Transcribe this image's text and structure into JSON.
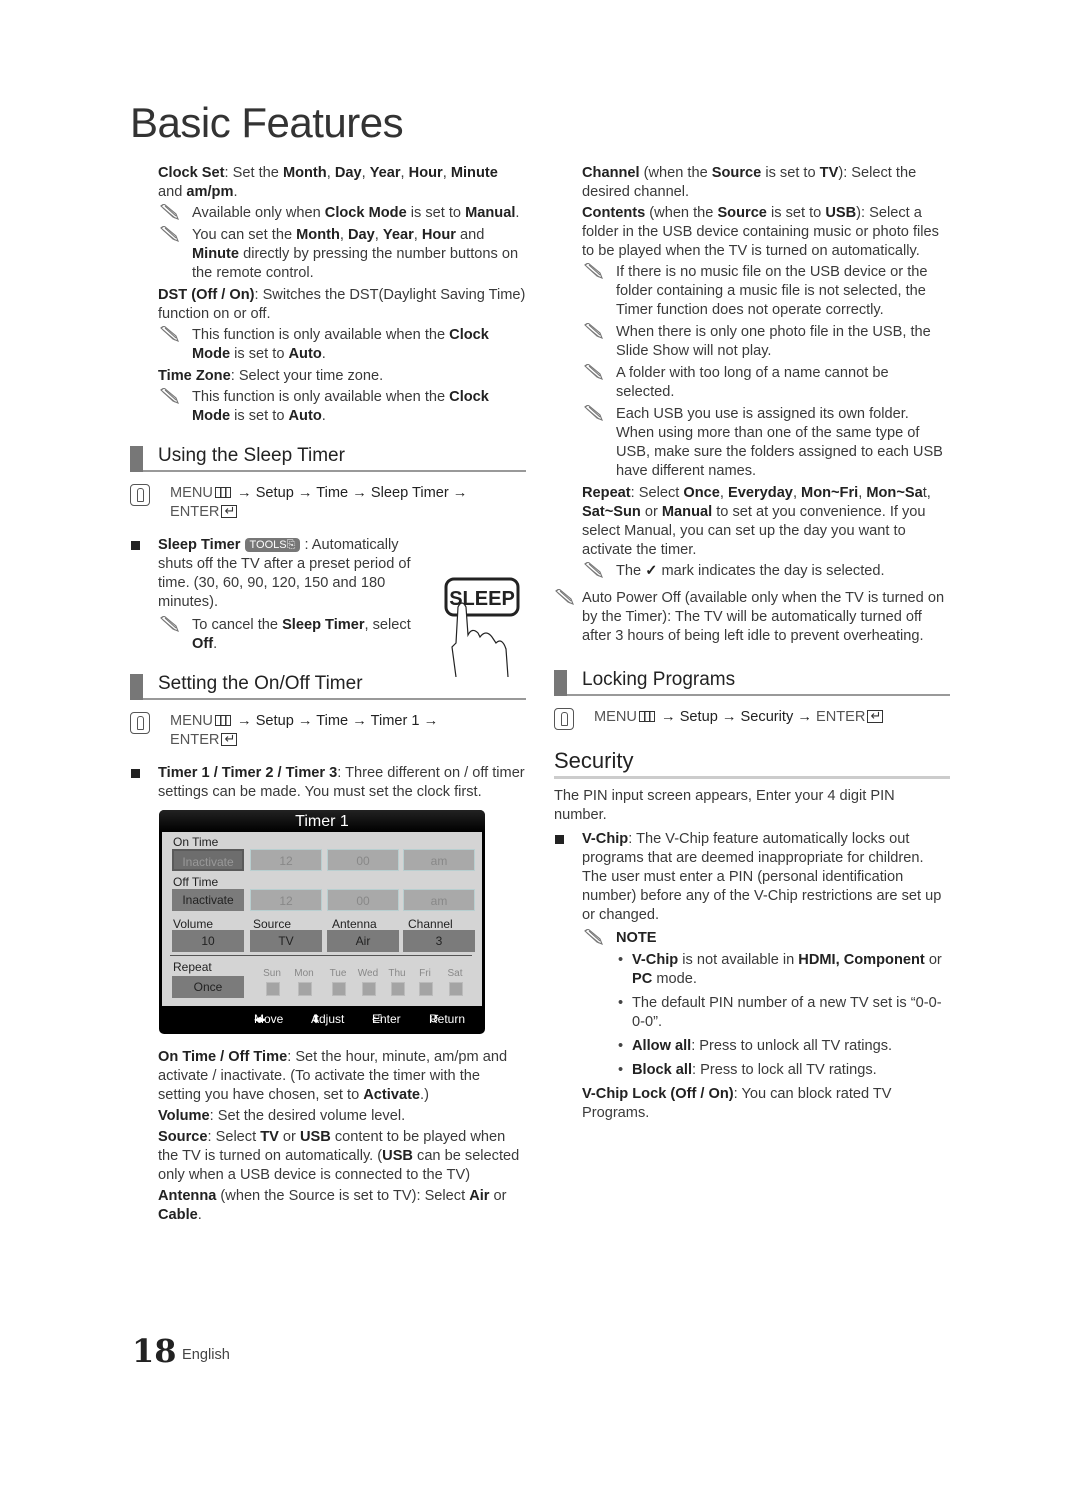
{
  "page": {
    "title": "Basic Features",
    "page_number": "18",
    "language": "English"
  },
  "icons": {
    "note": "pencil-note-icon",
    "remote": "remote-hand-icon",
    "menu": "menu-icon",
    "enter": "enter-icon",
    "tools": "tools-icon",
    "sleep_button": "sleep-button-icon"
  },
  "left": {
    "clock_set": {
      "label": "Clock Set",
      "text": ": Set the ",
      "b1": "Month",
      "s1": ", ",
      "b2": "Day",
      "s2": ", ",
      "b3": "Year",
      "s3": ", ",
      "b4": "Hour",
      "s4": ", ",
      "b5": "Minute",
      "s5": " and ",
      "b6": "am/pm",
      "end": "."
    },
    "note1": {
      "t1": "Available only when ",
      "b1": "Clock Mode",
      "t2": " is set to ",
      "b2": "Manual",
      "t3": "."
    },
    "note2": {
      "t1": "You can set the ",
      "b1": "Month",
      "s1": ", ",
      "b2": "Day",
      "s2": ", ",
      "b3": "Year",
      "s3": ", ",
      "b4": "Hour",
      "t2": " and ",
      "b5": "Minute",
      "t3": " directly by pressing the number buttons on the remote control."
    },
    "dst": {
      "label": "DST (Off / On)",
      "text": ": Switches the DST(Daylight Saving Time) function on or off."
    },
    "note3": {
      "t1": "This function is only available when the ",
      "b1": "Clock Mode",
      "t2": " is set to ",
      "b2": "Auto",
      "t3": "."
    },
    "time_zone": {
      "label": "Time Zone",
      "text": ": Select your time zone."
    },
    "note4": {
      "t1": "This function is only available when the ",
      "b1": "Clock Mode",
      "t2": " is set to ",
      "b2": "Auto",
      "t3": "."
    },
    "sleep_section": {
      "heading": "Using the Sleep Timer",
      "menu": "MENU",
      "path": "→ Setup → Time → Sleep Timer →",
      "enter": "ENTER",
      "bullet_label": "Sleep Timer",
      "tools": "TOOLS",
      "bullet_text": " : Automatically shuts off the TV after a preset period of time. (30, 60, 90, 120, 150 and 180 minutes).",
      "note": {
        "t1": "To cancel the ",
        "b1": "Sleep Timer",
        "t2": ", select ",
        "b2": "Off",
        "t3": "."
      },
      "sleep_button_label": "SLEEP"
    },
    "timer_section": {
      "heading": "Setting the On/Off Timer",
      "menu": "MENU",
      "path": "→ Setup → Time → Timer 1 →",
      "enter": "ENTER",
      "bullet_label": "Timer 1 / Timer 2 / Timer 3",
      "bullet_text": ": Three different on / off timer settings can be made. You must set the clock first."
    },
    "osd": {
      "title": "Timer 1",
      "on_time_label": "On Time",
      "on_time": [
        "Inactivate",
        "12",
        "00",
        "am"
      ],
      "off_time_label": "Off Time",
      "off_time": [
        "Inactivate",
        "12",
        "00",
        "am"
      ],
      "volume_label": "Volume",
      "volume": "10",
      "source_label": "Source",
      "source": "TV",
      "antenna_label": "Antenna",
      "antenna": "Air",
      "channel_label": "Channel",
      "channel": "3",
      "repeat_label": "Repeat",
      "repeat": "Once",
      "days": [
        "Sun",
        "Mon",
        "Tue",
        "Wed",
        "Thu",
        "Fri",
        "Sat"
      ],
      "footer": {
        "move": "Move",
        "adjust": "Adjust",
        "enter": "Enter",
        "return": "Return"
      }
    },
    "on_off_time": {
      "label": "On Time / Off Time",
      "t1": ": Set the hour, minute, am/pm and activate / inactivate. (To activate the timer with the setting you have chosen, set to ",
      "b1": "Activate",
      "t2": ".)"
    },
    "volume": {
      "label": "Volume",
      "text": ": Set the desired volume level."
    },
    "source": {
      "label": "Source",
      "t1": ": Select ",
      "b1": "TV",
      "t2": " or ",
      "b2": "USB",
      "t3": " content to be played when the TV is turned on automatically. (",
      "b3": "USB",
      "t4": " can be selected only when a USB device is connected to the TV)"
    },
    "antenna": {
      "label": "Antenna",
      "t1": " (when the Source is set to TV): Select ",
      "b1": "Air",
      "t2": " or ",
      "b2": "Cable",
      "t3": "."
    }
  },
  "right": {
    "channel": {
      "label": "Channel",
      "t1": " (when the ",
      "b1": "Source",
      "t2": " is set to ",
      "b2": "TV",
      "t3": "): Select the desired channel."
    },
    "contents": {
      "label": "Contents",
      "t1": " (when the ",
      "b1": "Source",
      "t2": " is set to ",
      "b2": "USB",
      "t3": "): Select a folder in the USB device containing music or photo files to be played when the TV is turned on automatically."
    },
    "notes": [
      "If there is no music file on the USB device or the folder containing a music file is not selected, the Timer function does not operate correctly.",
      "When there is only one photo file in the USB, the Slide Show will not play.",
      "A folder with too long of a name cannot be selected.",
      "Each USB you use is assigned its own folder. When using more than one of the same type of USB, make sure the folders assigned to each USB have different names."
    ],
    "repeat": {
      "label": "Repeat",
      "t1": ": Select ",
      "b1": "Once",
      "s1": ", ",
      "b2": "Everyday",
      "s2": ", ",
      "b3": "Mon~Fri",
      "s3": ", ",
      "b4": "Mon~Sa",
      "t2": "t, ",
      "b5": "Sat~Sun",
      "t3": " or ",
      "b6": "Manual",
      "t4": " to set at you convenience. If you select Manual, you can set up the day you want to activate the timer."
    },
    "check_note": {
      "t1": "The ",
      "t2": " mark indicates the day is selected."
    },
    "auto_power_off": "Auto Power Off (available only when the TV is turned on by the Timer): The TV will be automatically turned off after 3 hours of being left idle to prevent overheating.",
    "locking_section": {
      "heading": "Locking Programs",
      "menu": "MENU",
      "path1": "→ ",
      "setup": "Setup",
      "path2": " → ",
      "security": "Security",
      "path3": " → ",
      "enter": "ENTER"
    },
    "security": {
      "heading": "Security",
      "intro": "The PIN input screen appears, Enter your 4 digit PIN number.",
      "vchip": {
        "label": "V-Chip",
        "text": ": The V-Chip feature automatically locks out programs that are deemed inappropriate for children. The user must enter a PIN (personal identification number) before any of the V-Chip restrictions are set up or changed."
      },
      "note_label": "NOTE",
      "dots": {
        "d1": {
          "b1": "V-Chip",
          "t1": " is not available in ",
          "b2": "HDMI, Component",
          "t2": " or ",
          "b3": "PC",
          "t3": " mode."
        },
        "d2": "The default PIN number of a new TV set is “0-0-0-0”.",
        "d3": {
          "b1": "Allow all",
          "t1": ": Press to unlock all TV ratings."
        },
        "d4": {
          "b1": "Block all",
          "t1": ": Press to lock all TV ratings."
        }
      },
      "vchip_lock": {
        "label": "V-Chip Lock (Off / On)",
        "text": ": You can block rated TV Programs."
      }
    }
  }
}
